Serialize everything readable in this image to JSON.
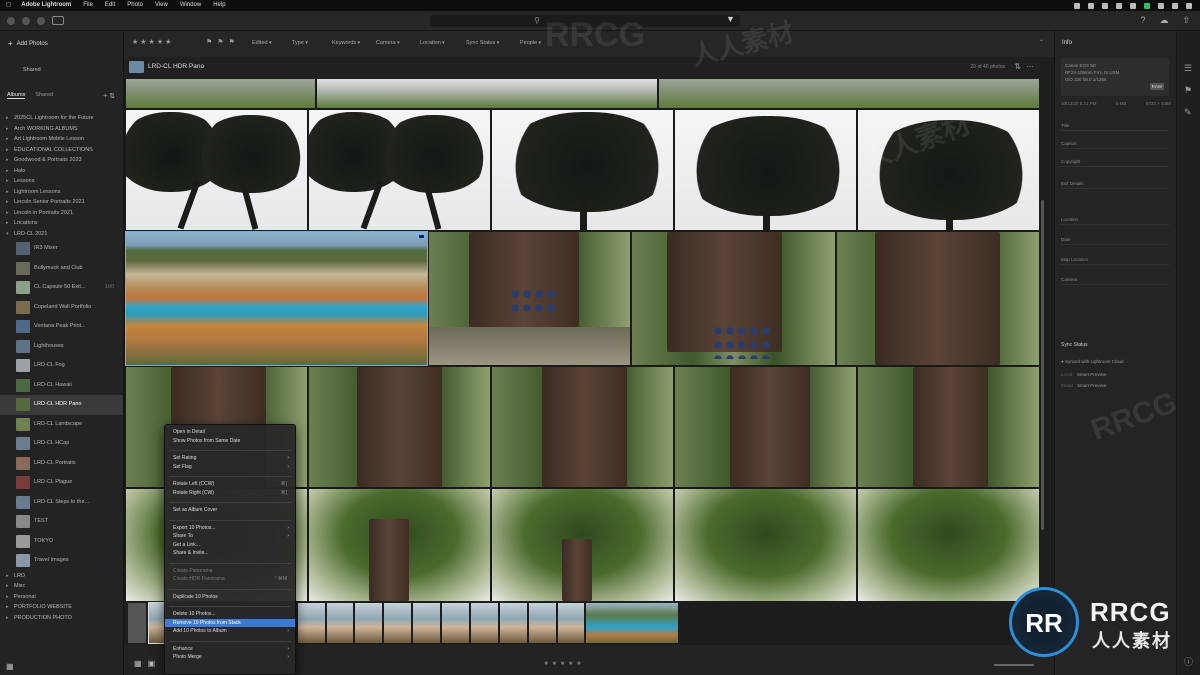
{
  "menubar": {
    "app": "Adobe Lightroom",
    "items": [
      "File",
      "Edit",
      "Photo",
      "View",
      "Window",
      "Help"
    ]
  },
  "left": {
    "add_photos": "Add Photos",
    "shared": "Shared",
    "tabs": [
      "Albums",
      "Shared"
    ],
    "albums": [
      {
        "label": "2025CL Lightroom for the Future",
        "thumb": false
      },
      {
        "label": "Arch WORKING ALBUMS",
        "thumb": false
      },
      {
        "label": "Art Lightroom Mobile Lesson",
        "thumb": false
      },
      {
        "label": "EDUCATIONAL COLLECTIONS",
        "thumb": false
      },
      {
        "label": "Goodwood & Portraits 2023",
        "thumb": false
      },
      {
        "label": "Halo",
        "thumb": false
      },
      {
        "label": "Lessons",
        "thumb": false
      },
      {
        "label": "Lightroom Lessons",
        "thumb": false
      },
      {
        "label": "Lincoln Senior Portraits 2021",
        "thumb": false
      },
      {
        "label": "Lincoln in Portraits 2021",
        "thumb": false
      },
      {
        "label": "Locations",
        "thumb": false
      },
      {
        "label": "LRD-CL 2021",
        "thumb": false,
        "open": true
      },
      {
        "label": "IR3 Mixer",
        "thumb": true,
        "count": "",
        "color": "#556070"
      },
      {
        "label": "Bullymuck and Club",
        "thumb": true,
        "count": "",
        "color": "#6b6a58"
      },
      {
        "label": "CL Capsule 50 Exit...",
        "thumb": true,
        "count": "100",
        "color": "#8fa088"
      },
      {
        "label": "Copeland Wall Portfolio",
        "thumb": true,
        "count": "",
        "color": "#7c6a4e"
      },
      {
        "label": "Ventana Peak Print...",
        "thumb": true,
        "count": "",
        "color": "#4d6a8a"
      },
      {
        "label": "Lighthouses",
        "thumb": true,
        "count": "",
        "color": "#5d7486"
      },
      {
        "label": "LRD-CL Fog",
        "thumb": true,
        "count": "",
        "color": "#9aa2a8"
      },
      {
        "label": "LRD-CL Hawaii",
        "thumb": true,
        "count": "",
        "color": "#4c6a42"
      },
      {
        "label": "LRD-CL HDR Pano",
        "thumb": true,
        "count": "",
        "color": "#556b3e",
        "selected": true
      },
      {
        "label": "LRD-CL Landscape",
        "thumb": true,
        "count": "",
        "color": "#70824f"
      },
      {
        "label": "LRD-CL HCap",
        "thumb": true,
        "count": "",
        "color": "#6a7d8e"
      },
      {
        "label": "LRD-CL Portraits",
        "thumb": true,
        "count": "",
        "color": "#8b6a5a"
      },
      {
        "label": "LRD-CL Plague",
        "thumb": true,
        "count": "",
        "color": "#7a3b3b"
      },
      {
        "label": "LRD-CL Steps to the...",
        "thumb": true,
        "count": "",
        "color": "#6a7c90"
      },
      {
        "label": "TEST",
        "thumb": true,
        "count": "",
        "color": "#888"
      },
      {
        "label": "TOKYO",
        "thumb": true,
        "count": "",
        "color": "#999"
      },
      {
        "label": "Travel Images",
        "thumb": true,
        "count": "",
        "color": "#8a98a8"
      },
      {
        "label": "LRD",
        "thumb": false
      },
      {
        "label": "Misc",
        "thumb": false
      },
      {
        "label": "Personal",
        "thumb": false
      },
      {
        "label": "PORTFOLIO WEBSITE",
        "thumb": false
      },
      {
        "label": "PRODUCTION PHOTO",
        "thumb": false
      }
    ]
  },
  "filterbar": {
    "filters": [
      "Edited",
      "Type",
      "Keywords",
      "Camera",
      "Location",
      "Sync Status",
      "People"
    ]
  },
  "album_header": {
    "title": "LRD-CL HDR Pano",
    "count": "20 of 40 photos"
  },
  "context_menu": {
    "items": [
      {
        "label": "Open in Detail",
        "type": "item"
      },
      {
        "label": "Show Photos from Same Date",
        "type": "item"
      },
      {
        "type": "sep"
      },
      {
        "label": "Set Rating",
        "type": "sub"
      },
      {
        "label": "Set Flag",
        "type": "sub"
      },
      {
        "type": "sep"
      },
      {
        "label": "Rotate Left (CCW)",
        "type": "item",
        "sc": "⌘["
      },
      {
        "label": "Rotate Right (CW)",
        "type": "item",
        "sc": "⌘]"
      },
      {
        "type": "sep"
      },
      {
        "label": "Set as Album Cover",
        "type": "item"
      },
      {
        "type": "sep"
      },
      {
        "label": "Export 10 Photos...",
        "type": "sub"
      },
      {
        "label": "Share To",
        "type": "sub"
      },
      {
        "label": "Get a Link...",
        "type": "item"
      },
      {
        "label": "Share & Invite...",
        "type": "item"
      },
      {
        "type": "sep"
      },
      {
        "label": "Create Panorama",
        "type": "dis"
      },
      {
        "label": "Create HDR Panorama",
        "type": "dis",
        "sc": "⌃⌘M"
      },
      {
        "type": "sep"
      },
      {
        "label": "Duplicate 10 Photos",
        "type": "item"
      },
      {
        "type": "sep"
      },
      {
        "label": "Delete 10 Photos...",
        "type": "item"
      },
      {
        "label": "Remove 10 Photos from Stack",
        "type": "hl"
      },
      {
        "label": "Add 10 Photos to Album",
        "type": "sub"
      },
      {
        "type": "sep"
      },
      {
        "label": "Enhance",
        "type": "sub"
      },
      {
        "label": "Photo Merge",
        "type": "sub"
      }
    ]
  },
  "info_panel": {
    "title": "Info",
    "file": "Canon EOS 5D",
    "lines": [
      "RF24-105mm F4 L IS USM",
      "ISO 100   f/8.0   1/125s",
      "10mm   f/8.0   1/8000 s"
    ],
    "badge": "RAW",
    "meta": [
      "10/12/20  5:21 PM",
      "5 MB",
      "6720 × 4480"
    ],
    "fields": [
      "Title",
      "Caption",
      "Copyright",
      "Exif Details",
      "Location",
      "Date",
      "Map Location",
      "Camera"
    ],
    "sync_heading": "Sync Status",
    "sync_line": "Synced with Lightroom Cloud",
    "sync_rows": [
      {
        "label": "Local",
        "value": "Smart Preview"
      },
      {
        "label": "Cloud",
        "value": "Smart Preview"
      }
    ]
  },
  "watermark": {
    "brand": "RRCG",
    "cn": "人人素材"
  },
  "colors": {
    "accent": "#3d7bd4",
    "panel": "#232323"
  }
}
